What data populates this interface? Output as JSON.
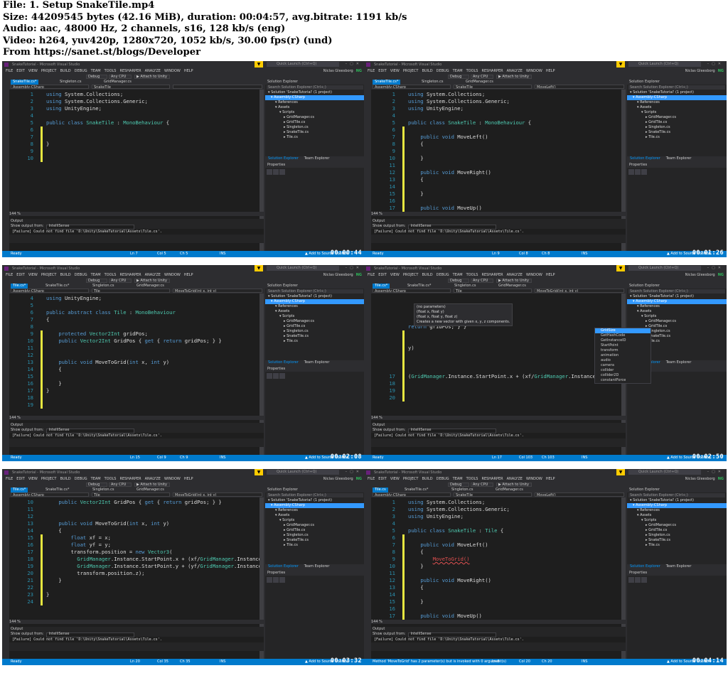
{
  "header": {
    "file": "File: 1. Setup SnakeTile.mp4",
    "size": "Size: 44209545 bytes (42.16 MiB), duration: 00:04:57, avg.bitrate: 1191 kb/s",
    "audio": "Audio: aac, 48000 Hz, 2 channels, s16, 128 kb/s (eng)",
    "video": "Video: h264, yuv420p, 1280x720, 1052 kb/s, 30.00 fps(r) (und)",
    "from": "From https://sanet.st/blogs/Developer"
  },
  "ide": {
    "title": "SnakeTutorial - Microsoft Visual Studio",
    "quick_launch": "Quick Launch (Ctrl+Q)",
    "menu": [
      "FILE",
      "EDIT",
      "VIEW",
      "PROJECT",
      "BUILD",
      "DEBUG",
      "TEAM",
      "TOOLS",
      "RESHARPER",
      "ANALYZE",
      "WINDOW",
      "HELP"
    ],
    "user": "Niclas Gleesborg",
    "user_initials": "NG",
    "debug": "Debug",
    "cpu": "Any CPU",
    "attach": "Attach to Unity",
    "zoom": "144 %",
    "output_title": "Output",
    "show_output_from": "Show output from:",
    "output_source": "IntelliSense",
    "output_message": "[Failure] Could not find file 'D:\\Unity\\SnakeTutorial\\Assets\\Tile.cs'.",
    "se_title": "Solution Explorer",
    "se_search": "Search Solution Explorer (Ctrl+;)",
    "se_tree": [
      "Solution 'SnakeTutorial' (1 project)",
      "Assembly-CSharp",
      "References",
      "Assets",
      "Scripts",
      "GridManager.cs",
      "GridTile.cs",
      "Singleton.cs",
      "SnakeTile.cs",
      "Tile.cs"
    ],
    "se_tabs": [
      "Solution Explorer",
      "Team Explorer"
    ],
    "properties": "Properties",
    "status_ready": "Ready",
    "add_source": "Add to Source Control",
    "ins": "INS"
  },
  "frames": [
    {
      "stamp": "",
      "tabs": [
        "SnakeTile.cs*",
        "Singleton.cs",
        "GridManager.cs"
      ],
      "nav": [
        "Assembly-CSharp",
        "SnakeTile",
        ""
      ],
      "status": [
        "Ln 7",
        "Col 5",
        "Ch 5"
      ],
      "lines": [
        {
          "n": "1",
          "t": "using System.Collections;"
        },
        {
          "n": "2",
          "t": "using System.Collections.Generic;"
        },
        {
          "n": "3",
          "t": "using UnityEngine;"
        },
        {
          "n": "4",
          "t": ""
        },
        {
          "n": "5",
          "t": "public class SnakeTile : MonoBehaviour {"
        },
        {
          "n": "6",
          "t": ""
        },
        {
          "n": "7",
          "t": ""
        },
        {
          "n": "8",
          "t": "}"
        },
        {
          "n": "9",
          "t": ""
        },
        {
          "n": "10",
          "t": ""
        }
      ]
    },
    {
      "stamp": "00:00:44",
      "tabs": [
        "SnakeTile.cs*",
        "Singleton.cs",
        "GridManager.cs"
      ],
      "nav": [
        "Assembly-CSharp",
        "SnakeTile",
        "MoveLeft()"
      ],
      "status": [
        "Ln 9",
        "Col 8",
        "Ch 8"
      ],
      "lines": [
        {
          "n": "1",
          "t": "using System.Collections;"
        },
        {
          "n": "2",
          "t": "using System.Collections.Generic;"
        },
        {
          "n": "3",
          "t": "using UnityEngine;"
        },
        {
          "n": "4",
          "t": ""
        },
        {
          "n": "5",
          "t": "public class SnakeTile : MonoBehaviour {"
        },
        {
          "n": "6",
          "t": ""
        },
        {
          "n": "7",
          "t": "    public void MoveLeft()"
        },
        {
          "n": "8",
          "t": "    {"
        },
        {
          "n": "9",
          "t": ""
        },
        {
          "n": "10",
          "t": "    }"
        },
        {
          "n": "11",
          "t": ""
        },
        {
          "n": "12",
          "t": "    public void MoveRight()"
        },
        {
          "n": "13",
          "t": "    {"
        },
        {
          "n": "14",
          "t": ""
        },
        {
          "n": "15",
          "t": "    }"
        },
        {
          "n": "16",
          "t": ""
        },
        {
          "n": "17",
          "t": "    public void MoveUp()"
        }
      ]
    },
    {
      "stamp": "00:01:26",
      "tabs": [
        "Tile.cs*",
        "SnakeTile.cs*",
        "Singleton.cs",
        "GridManager.cs"
      ],
      "nav": [
        "Assembly-CSharp",
        "Tile",
        "MoveToGrid(int x, int y)"
      ],
      "status": [
        "Ln 15",
        "Col 9",
        "Ch 9"
      ],
      "lines": [
        {
          "n": "4",
          "t": "using UnityEngine;"
        },
        {
          "n": "5",
          "t": ""
        },
        {
          "n": "6",
          "t": "public abstract class Tile : MonoBehaviour"
        },
        {
          "n": "7",
          "t": "{"
        },
        {
          "n": "8",
          "t": ""
        },
        {
          "n": "9",
          "t": "    protected Vector2Int gridPos;"
        },
        {
          "n": "10",
          "t": "    public Vector2Int GridPos { get { return gridPos; } }"
        },
        {
          "n": "11",
          "t": ""
        },
        {
          "n": "12",
          "t": ""
        },
        {
          "n": "13",
          "t": "    public void MoveToGrid(int x, int y)"
        },
        {
          "n": "14",
          "t": "    {"
        },
        {
          "n": "15",
          "t": ""
        },
        {
          "n": "16",
          "t": "    }"
        },
        {
          "n": "17",
          "t": "}"
        },
        {
          "n": "18",
          "t": ""
        },
        {
          "n": "19",
          "t": ""
        }
      ]
    },
    {
      "stamp": "00:02:08",
      "tabs": [
        "Tile.cs*",
        "SnakeTile.cs*",
        "Singleton.cs",
        "GridManager.cs"
      ],
      "nav": [
        "Assembly-CSharp",
        "Tile",
        "MoveToGrid(int x, int y)"
      ],
      "status": [
        "Ln 17",
        "Col 103",
        "Ch 103"
      ],
      "lines": [
        {
          "n": "",
          "t": ""
        },
        {
          "n": "",
          "t": ""
        },
        {
          "n": "",
          "t": ""
        },
        {
          "n": "",
          "t": ""
        },
        {
          "n": "",
          "t": "return gridPos; } }"
        },
        {
          "n": "",
          "t": ""
        },
        {
          "n": "",
          "t": ""
        },
        {
          "n": "",
          "t": "y)"
        },
        {
          "n": "",
          "t": ""
        },
        {
          "n": "",
          "t": ""
        },
        {
          "n": "",
          "t": ""
        },
        {
          "n": "17",
          "t": "(GridManager.Instance.StartPoint.x + (xf/GridManager.Instance.));"
        },
        {
          "n": "18",
          "t": ""
        },
        {
          "n": "19",
          "t": ""
        },
        {
          "n": "20",
          "t": ""
        }
      ],
      "tooltip": [
        "(no parameters)",
        "(float x, float y)",
        "(float x, float y, float z)",
        "Creates a new vector with given x, y, z components."
      ],
      "intellisense": [
        "GridSize",
        "GetHashCode",
        "GetInstanceID",
        "StartPoint",
        "transform",
        "animation",
        "audio",
        "camera",
        "collider",
        "collider2D",
        "constantForce"
      ]
    },
    {
      "stamp": "00:02:50",
      "tabs": [
        "Tile.cs*",
        "SnakeTile.cs*",
        "Singleton.cs",
        "GridManager.cs"
      ],
      "nav": [
        "Assembly-CSharp",
        "Tile",
        "MoveToGrid(int x, int y)"
      ],
      "status": [
        "Ln 20",
        "Col 35",
        "Ch 35"
      ],
      "lines": [
        {
          "n": "10",
          "t": "    public Vector2Int GridPos { get { return gridPos; } }"
        },
        {
          "n": "11",
          "t": ""
        },
        {
          "n": "12",
          "t": ""
        },
        {
          "n": "13",
          "t": "    public void MoveToGrid(int x, int y)"
        },
        {
          "n": "14",
          "t": "    {"
        },
        {
          "n": "15",
          "t": "        float xf = x;"
        },
        {
          "n": "16",
          "t": "        float yf = y;"
        },
        {
          "n": "17",
          "t": "        transform.position = new Vector3("
        },
        {
          "n": "18",
          "t": "          GridManager.Instance.StartPoint.x + (xf/GridManager.Instance."
        },
        {
          "n": "19",
          "t": "          GridManager.Instance.StartPoint.y + (yf/GridManager.Instance."
        },
        {
          "n": "20",
          "t": "          transform.position.z);"
        },
        {
          "n": "21",
          "t": "    }"
        },
        {
          "n": "22",
          "t": ""
        },
        {
          "n": "23",
          "t": "}"
        },
        {
          "n": "24",
          "t": ""
        }
      ]
    },
    {
      "stamp": "00:03:32",
      "tabs": [
        "Tile.cs",
        "SnakeTile.cs*",
        "Singleton.cs",
        "GridManager.cs"
      ],
      "nav": [
        "Assembly-CSharp",
        "SnakeTile",
        "MoveLeft()"
      ],
      "status": [
        "Ln 8",
        "Col 20",
        "Ch 20"
      ],
      "status_msg": "Method 'MoveToGrid' has 2 parameter(s) but is invoked with 0 argument(s)",
      "lines": [
        {
          "n": "1",
          "t": "using System.Collections;"
        },
        {
          "n": "2",
          "t": "using System.Collections.Generic;"
        },
        {
          "n": "3",
          "t": "using UnityEngine;"
        },
        {
          "n": "4",
          "t": ""
        },
        {
          "n": "5",
          "t": "public class SnakeTile : Tile {"
        },
        {
          "n": "6",
          "t": ""
        },
        {
          "n": "7",
          "t": "    public void MoveLeft()"
        },
        {
          "n": "8",
          "t": "    {"
        },
        {
          "n": "9",
          "t": "        MoveToGrid()"
        },
        {
          "n": "10",
          "t": "    }"
        },
        {
          "n": "11",
          "t": ""
        },
        {
          "n": "12",
          "t": "    public void MoveRight()"
        },
        {
          "n": "13",
          "t": "    {"
        },
        {
          "n": "14",
          "t": ""
        },
        {
          "n": "15",
          "t": "    }"
        },
        {
          "n": "16",
          "t": ""
        },
        {
          "n": "17",
          "t": "    public void MoveUp()"
        }
      ]
    }
  ],
  "last_stamp": "00:04:14"
}
